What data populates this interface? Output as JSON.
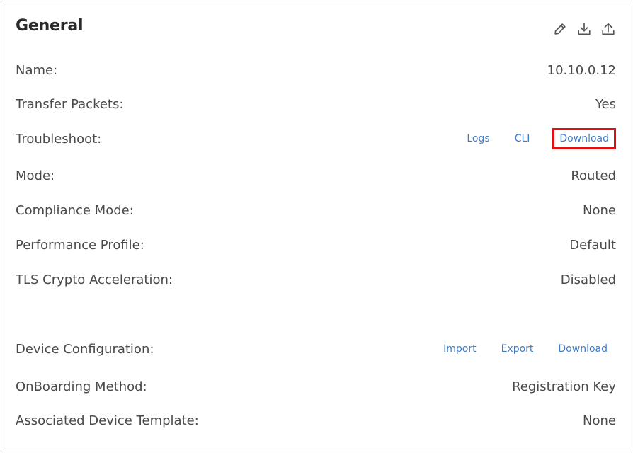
{
  "panel": {
    "title": "General",
    "header_icons": [
      {
        "name": "pencil-icon"
      },
      {
        "name": "download-icon"
      },
      {
        "name": "upload-icon"
      }
    ]
  },
  "rows": {
    "name": {
      "label": "Name:",
      "value": "10.10.0.12"
    },
    "transfer_packets": {
      "label": "Transfer Packets:",
      "value": "Yes"
    },
    "troubleshoot": {
      "label": "Troubleshoot:",
      "links": {
        "logs": "Logs",
        "cli": "CLI",
        "download": "Download"
      }
    },
    "mode": {
      "label": "Mode:",
      "value": "Routed"
    },
    "compliance_mode": {
      "label": "Compliance Mode:",
      "value": "None"
    },
    "performance_profile": {
      "label": "Performance Profile:",
      "value": "Default"
    },
    "tls_crypto": {
      "label": "TLS Crypto Acceleration:",
      "value": "Disabled"
    },
    "device_configuration": {
      "label": "Device Configuration:",
      "links": {
        "import": "Import",
        "export": "Export",
        "download": "Download"
      }
    },
    "onboarding_method": {
      "label": "OnBoarding Method:",
      "value": "Registration Key"
    },
    "associated_template": {
      "label": "Associated Device Template:",
      "value": "None"
    }
  },
  "colors": {
    "link": "#3f7cc7",
    "highlight": "#e01010",
    "text": "#4a4a4a",
    "icon": "#555555"
  }
}
